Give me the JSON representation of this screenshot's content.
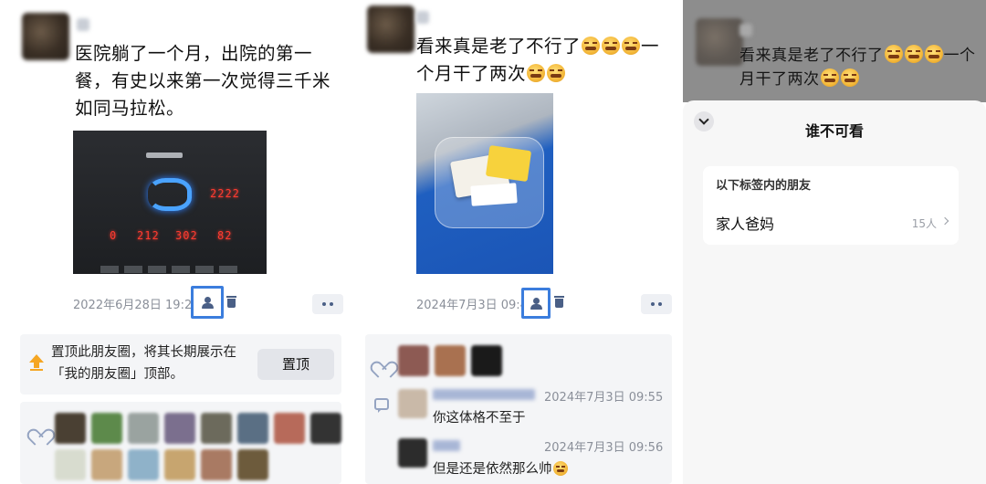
{
  "panel1": {
    "post_text": "医院躺了一个月，出院的第一餐，有史以来第一次觉得三千米如同马拉松。",
    "treadmill": {
      "led_top": "2222",
      "led_values": [
        "0",
        "212",
        "302",
        "82"
      ]
    },
    "timestamp": "2022年6月28日 19:2",
    "pin_card": {
      "text": "置顶此朋友圈，将其长期展示在「我的朋友圈」顶部。",
      "button": "置顶"
    }
  },
  "panel2": {
    "post_text": "看来真是老了不行了",
    "post_text_2": "一个月干了两次",
    "timestamp": "2024年7月3日 09:4",
    "comments": [
      {
        "time": "2024年7月3日 09:55",
        "text": "你这体格不至于"
      },
      {
        "time": "2024年7月3日 09:56",
        "text": "但是还是依然那么帅"
      }
    ]
  },
  "panel3": {
    "post_text": "看来真是老了不行了",
    "post_text_2": "一个月干了两次",
    "sheet": {
      "title": "谁不可看",
      "group_header": "以下标签内的朋友",
      "group_item": "家人爸妈",
      "group_count": "15人"
    }
  },
  "colors": {
    "highlight": "#3b7ddd",
    "pin": "#f5a623",
    "icon": "#4a5f86"
  },
  "icons": [
    "person-icon",
    "trash-icon",
    "more-icon",
    "pin-icon",
    "heart-icon",
    "comment-icon",
    "chevron-down-icon",
    "chevron-right-icon",
    "smile-emoji"
  ]
}
